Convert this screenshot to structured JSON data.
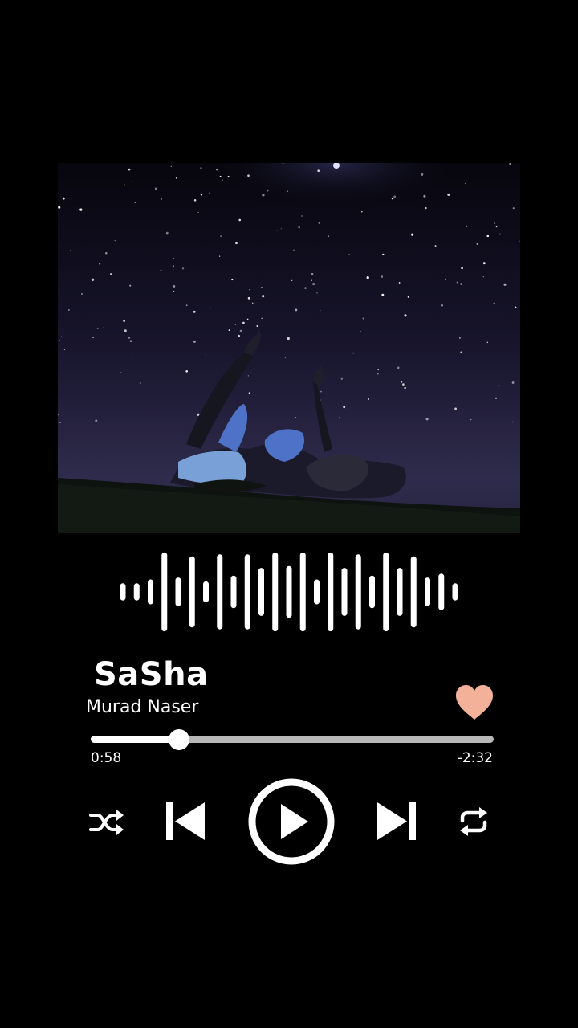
{
  "track": {
    "title": "SaSha",
    "artist": "Murad Naser",
    "elapsed": "0:58",
    "remaining": "-2:32",
    "progress_fraction": 0.22,
    "liked": true
  },
  "controls": {
    "shuffle_icon": "shuffle-icon",
    "previous_icon": "skip-previous-icon",
    "play_icon": "play-icon",
    "next_icon": "skip-next-icon",
    "repeat_icon": "repeat-icon",
    "like_icon": "heart-icon"
  },
  "waveform": {
    "bar_levels": [
      0.15,
      0.15,
      0.25,
      0.95,
      0.3,
      0.85,
      0.2,
      0.9,
      0.35,
      0.9,
      0.55,
      0.95,
      0.6,
      0.95,
      0.25,
      0.95,
      0.55,
      0.9,
      0.35,
      0.95,
      0.55,
      0.85,
      0.3,
      0.4,
      0.15
    ]
  },
  "colors": {
    "background": "#000000",
    "accent_heart": "#f4b199",
    "progress_track": "#b8b8b8",
    "progress_fill": "#ffffff"
  }
}
